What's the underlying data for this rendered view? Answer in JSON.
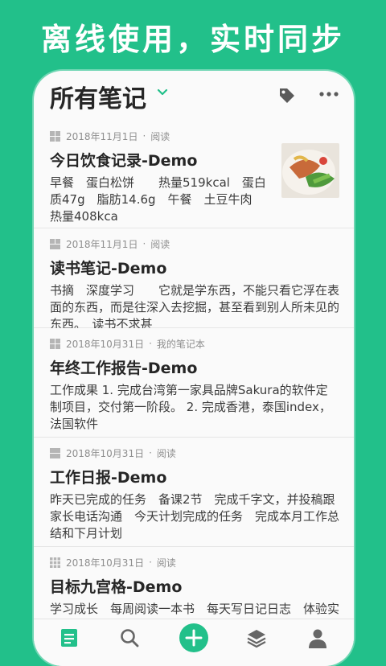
{
  "promo": {
    "headline": "离线使用，实时同步"
  },
  "header": {
    "title": "所有笔记",
    "dropdown_icon": "chevron-down-icon",
    "tag_icon": "tag-icon",
    "more_icon": "more-icon"
  },
  "notes": [
    {
      "date": "2018年11月1日",
      "notebook": "阅读",
      "title": "今日饮食记录-Demo",
      "body": "早餐　蛋白松饼　　热量519kcal　蛋白质47g　脂肪14.6g　午餐　土豆牛肉　　热量408kca",
      "has_thumbnail": true
    },
    {
      "date": "2018年11月1日",
      "notebook": "阅读",
      "title": "读书笔记-Demo",
      "body": "书摘　深度学习　　它就是学东西，不能只看它浮在表面的东西，而是往深入去挖掘，甚至看到别人所未见的东西。　读书不求甚"
    },
    {
      "date": "2018年10月31日",
      "notebook": "我的笔记本",
      "title": "年终工作报告-Demo",
      "body": "工作成果 1. 完成台湾第一家具品牌Sakura的软件定制项目，交付第一阶段。 2. 完成香港，泰国index，法国软件"
    },
    {
      "date": "2018年10月31日",
      "notebook": "阅读",
      "title": "工作日报-Demo",
      "body": "昨天已完成的任务　备课2节　完成千字文，并投稿跟家长电话沟通　今天计划完成的任务　完成本月工作总结和下月计划"
    },
    {
      "date": "2018年10月31日",
      "notebook": "阅读",
      "title": "目标九宫格-Demo",
      "body": "学习成长　每周阅读一本书　每天写日记日志　体验实"
    }
  ],
  "bottom_nav": [
    "notes-icon",
    "search-icon",
    "add-icon",
    "notebooks-icon",
    "profile-icon"
  ],
  "colors": {
    "brand": "#22c08a",
    "background": "#fafafa",
    "text": "#262626",
    "meta": "#8e8e8e"
  }
}
